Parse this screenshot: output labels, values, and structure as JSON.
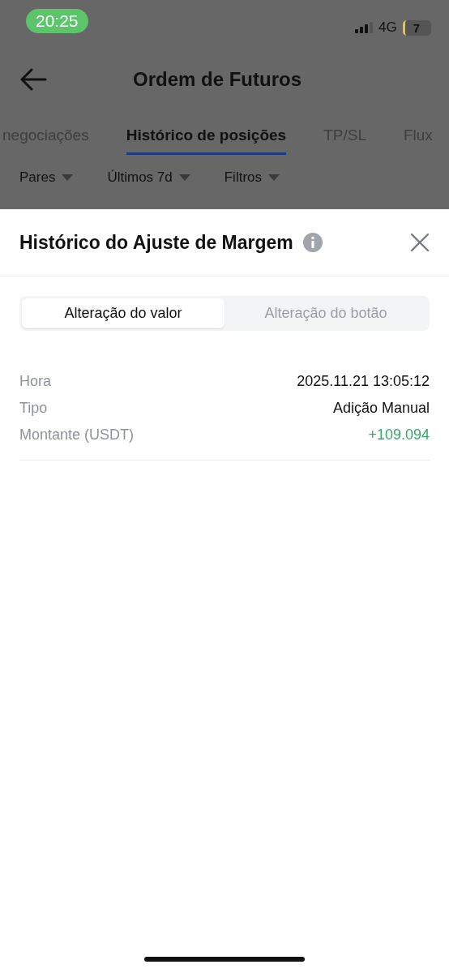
{
  "status_bar": {
    "time": "20:25",
    "network": "4G",
    "battery": "7"
  },
  "header": {
    "title": "Ordem de Futuros"
  },
  "tabs": [
    {
      "label": "negociações",
      "selected": false
    },
    {
      "label": "Histórico de posições",
      "selected": true
    },
    {
      "label": "TP/SL",
      "selected": false
    },
    {
      "label": "Flux",
      "selected": false
    }
  ],
  "filters": [
    "Pares",
    "Últimos 7d",
    "Filtros"
  ],
  "sheet": {
    "title": "Histórico do Ajuste de Margem",
    "segments": [
      {
        "label": "Alteração do valor",
        "selected": true
      },
      {
        "label": "Alteração do botão",
        "selected": false
      }
    ],
    "rows": [
      {
        "label": "Hora",
        "value": "2025.11.21 13:05:12",
        "kind": "plain"
      },
      {
        "label": "Tipo",
        "value": "Adição Manual",
        "kind": "plain"
      },
      {
        "label": "Montante (USDT)",
        "value": "+109.094",
        "kind": "gain"
      }
    ]
  }
}
